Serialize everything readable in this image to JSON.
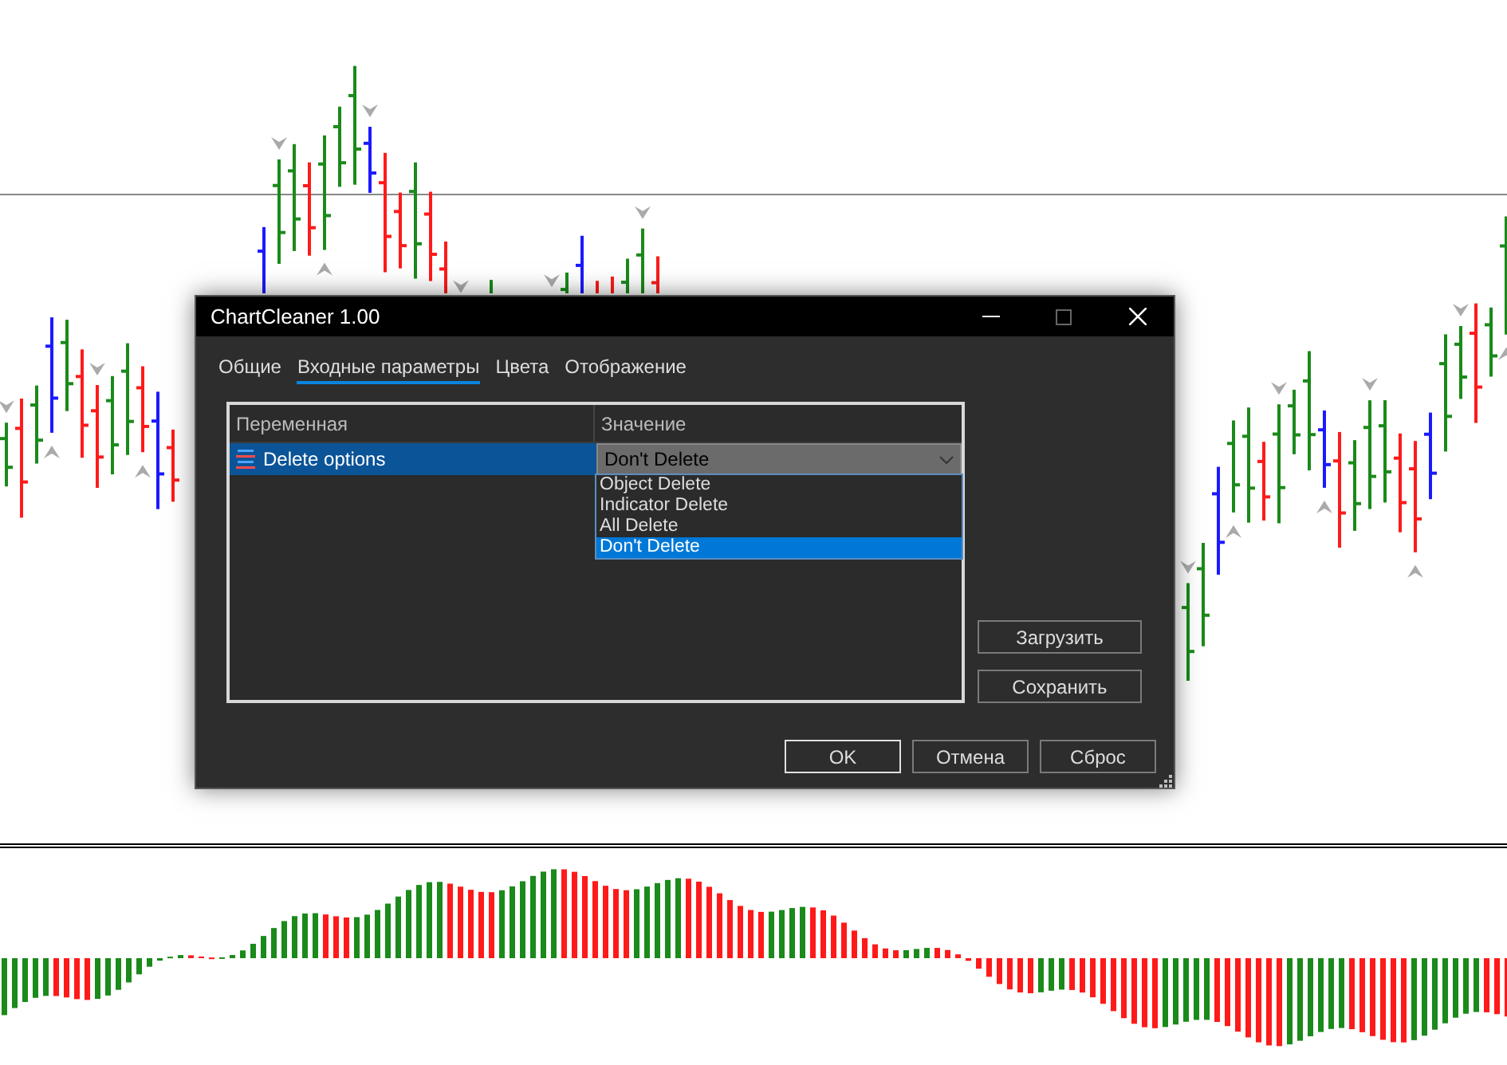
{
  "window": {
    "title": "ChartCleaner 1.00"
  },
  "tabs": [
    {
      "label": "Общие",
      "selected": false
    },
    {
      "label": "Входные параметры",
      "selected": true
    },
    {
      "label": "Цвета",
      "selected": false
    },
    {
      "label": "Отображение",
      "selected": false
    }
  ],
  "table": {
    "columns": [
      "Переменная",
      "Значение"
    ],
    "rows": [
      {
        "name": "Delete options",
        "value": "Don't Delete",
        "selected": true
      }
    ]
  },
  "dropdown": {
    "expanded": true,
    "options": [
      {
        "label": "Object Delete",
        "selected": false
      },
      {
        "label": "Indicator Delete",
        "selected": false
      },
      {
        "label": "All Delete",
        "selected": false
      },
      {
        "label": "Don't Delete",
        "selected": true
      }
    ]
  },
  "side_buttons": [
    "Загрузить",
    "Сохранить"
  ],
  "footer_buttons": [
    {
      "label": "OK",
      "default": true
    },
    {
      "label": "Отмена",
      "default": false
    },
    {
      "label": "Сброс",
      "default": false
    }
  ]
}
